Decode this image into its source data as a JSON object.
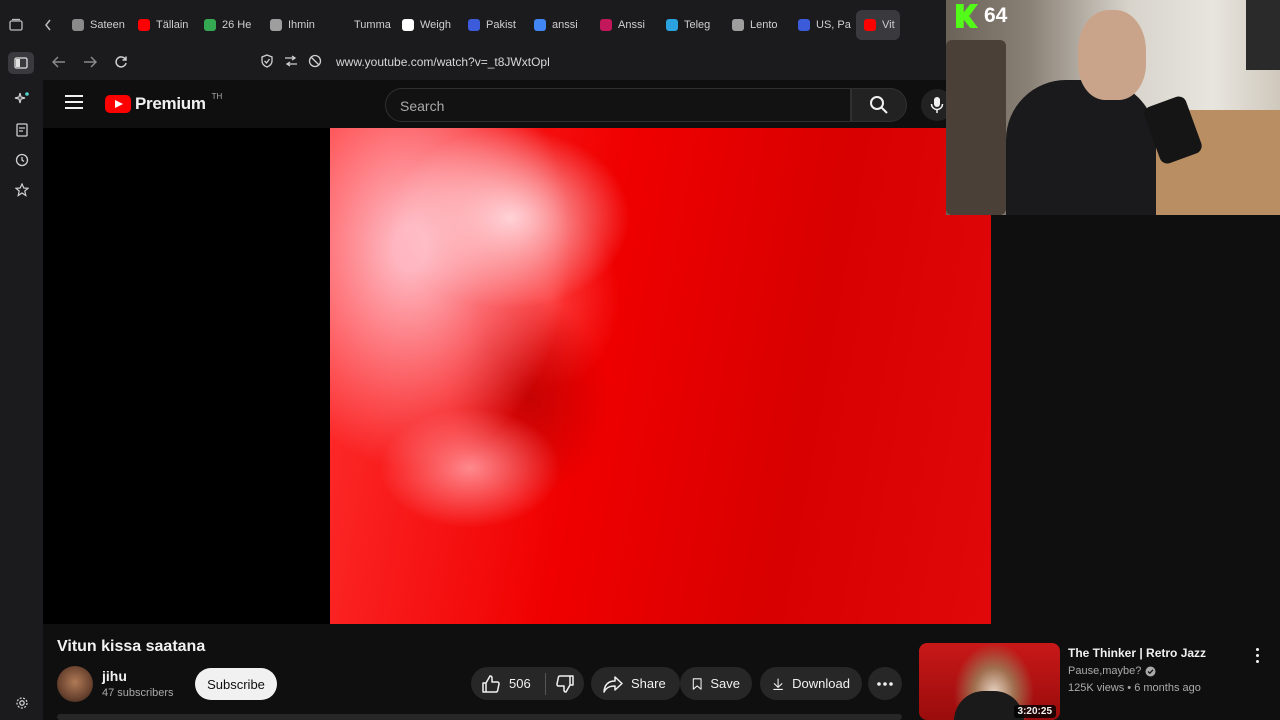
{
  "browser": {
    "tabs": [
      {
        "label": "Sateen",
        "color": "#8a8a8a"
      },
      {
        "label": "Tällain",
        "color": "#ff0000"
      },
      {
        "label": "26 He",
        "color": "#34a853"
      },
      {
        "label": "Ihmin",
        "color": "#9e9e9e"
      },
      {
        "label": "Tumma Sä",
        "color": "#1b1b1d"
      },
      {
        "label": "Weigh",
        "color": "#ffffff"
      },
      {
        "label": "Pakist",
        "color": "#3b5bdb"
      },
      {
        "label": "anssi",
        "color": "#4285f4"
      },
      {
        "label": "Anssi",
        "color": "#c2185b"
      },
      {
        "label": "Teleg",
        "color": "#2aa3e0"
      },
      {
        "label": "Lento",
        "color": "#9e9e9e"
      },
      {
        "label": "US, Pa",
        "color": "#3b5bdb"
      },
      {
        "label": "Vit",
        "color": "#ff0000"
      }
    ],
    "url": "www.youtube.com/watch?v=_t8JWxtOpl"
  },
  "youtube": {
    "logo_text": "Premium",
    "logo_sup": "TH",
    "search_placeholder": "Search",
    "video_title": "Vitun kissa saatana",
    "channel_name": "jihu",
    "channel_subs": "47 subscribers",
    "subscribe_label": "Subscribe",
    "like_count": "506",
    "share_label": "Share",
    "save_label": "Save",
    "download_label": "Download"
  },
  "overlay": {
    "viewer_count": "64"
  },
  "recommended": {
    "title": "The Thinker  |  Retro Jazz",
    "channel": "Pause,maybe?",
    "meta": "125K views • 6 months ago",
    "duration": "3:20:25"
  },
  "colors": {
    "youtube_red": "#ff0000",
    "kick_green": "#53fc18",
    "background": "#0f0f0f"
  }
}
